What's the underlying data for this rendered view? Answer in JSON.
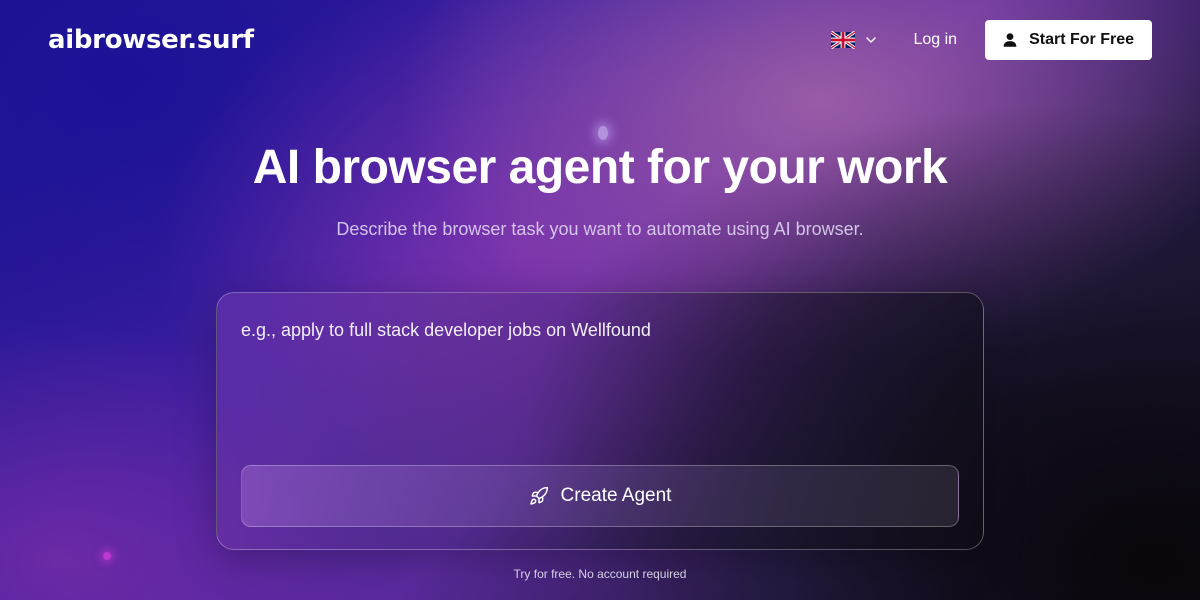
{
  "header": {
    "logo": "aibrowser.surf",
    "language": {
      "icon": "uk-flag-icon",
      "chevron": "chevron-down-icon"
    },
    "login_label": "Log in",
    "start_button": {
      "label": "Start For Free",
      "icon": "user-icon"
    }
  },
  "hero": {
    "title": "AI browser agent for your work",
    "subtitle": "Describe the browser task you want to automate using AI browser."
  },
  "task": {
    "placeholder": "e.g., apply to full stack developer jobs on Wellfound",
    "value": "",
    "button": {
      "label": "Create Agent",
      "icon": "rocket-icon"
    }
  },
  "footnote": "Try for free. No account required",
  "colors": {
    "button_bg": "#ffffff",
    "button_text": "#111111",
    "bg_top_left": "#1a1490",
    "bg_bottom_right": "#0e0a14",
    "accent_purple": "#9640b4"
  }
}
